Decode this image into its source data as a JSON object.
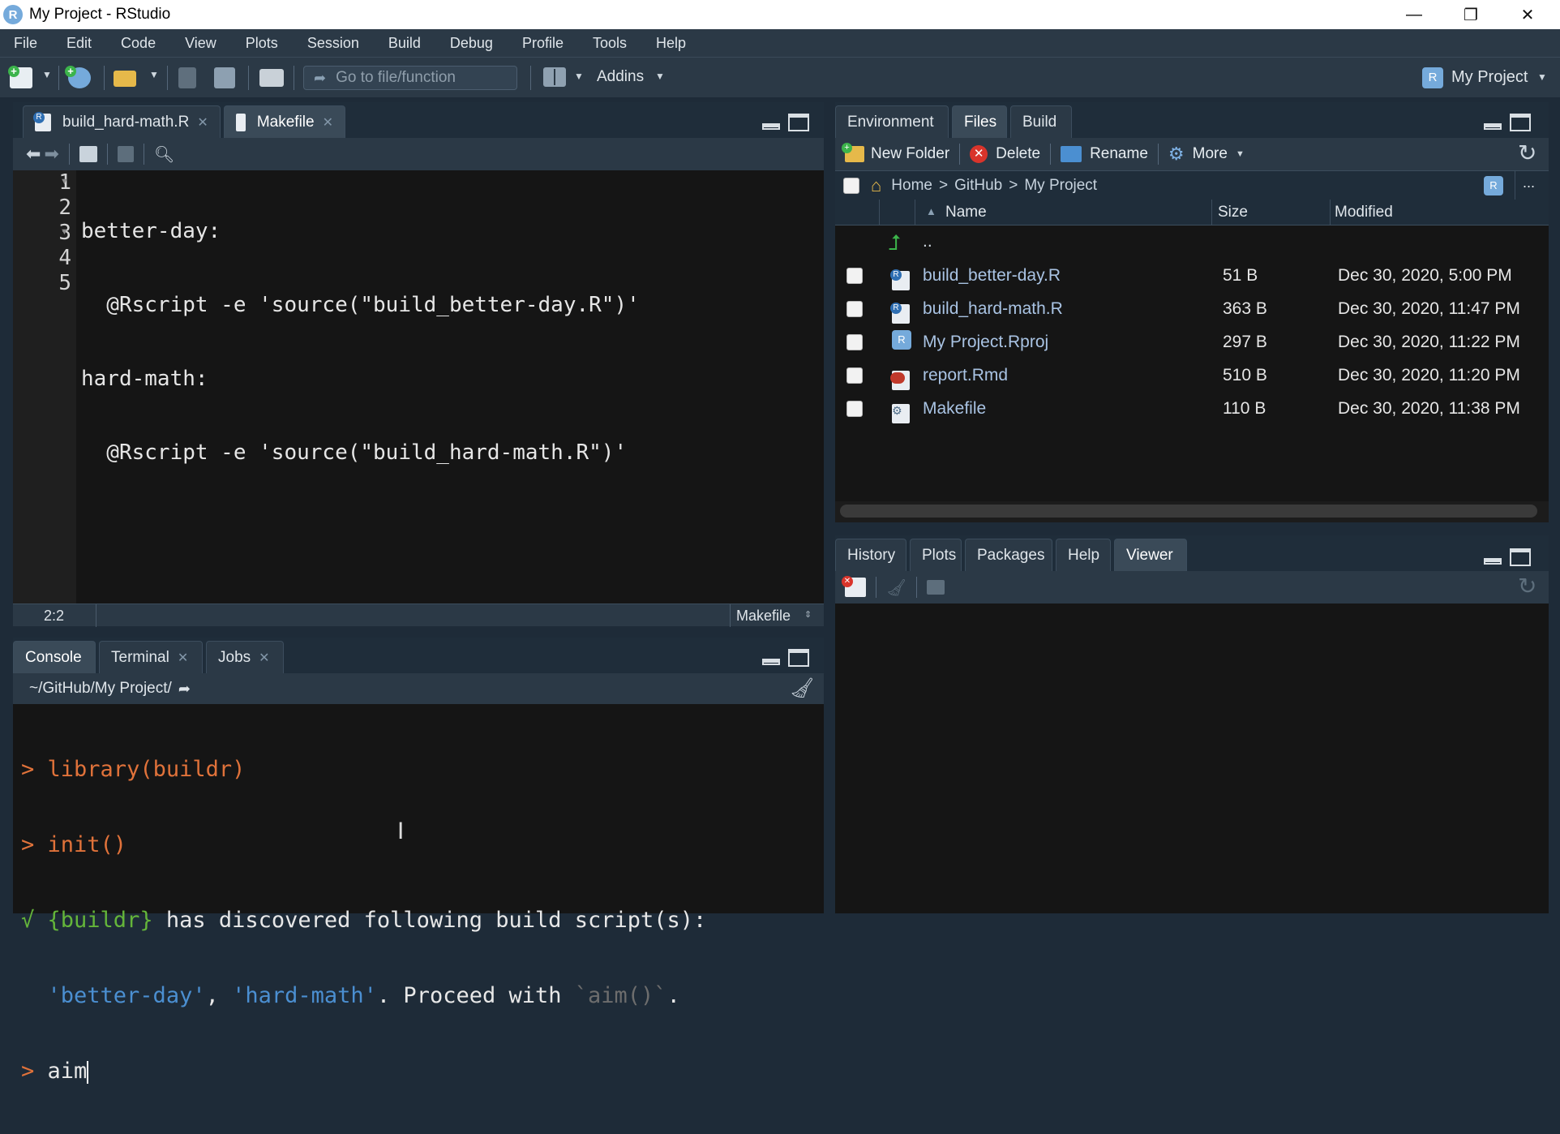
{
  "window": {
    "title": "My Project - RStudio",
    "minimize": "—",
    "restore": "❐",
    "close": "✕"
  },
  "menubar": [
    "File",
    "Edit",
    "Code",
    "View",
    "Plots",
    "Session",
    "Build",
    "Debug",
    "Profile",
    "Tools",
    "Help"
  ],
  "toolbar": {
    "goto_placeholder": "Go to file/function",
    "addins_label": "Addins",
    "project_label": "My Project"
  },
  "editor": {
    "tabs": [
      {
        "label": "build_hard-math.R"
      },
      {
        "label": "Makefile"
      }
    ],
    "line_numbers": [
      "1",
      "2",
      "3",
      "4",
      "5"
    ],
    "lines": [
      "better-day:",
      "  @Rscript -e 'source(\"build_better-day.R\")'",
      "hard-math:",
      "  @Rscript -e 'source(\"build_hard-math.R\")'",
      ""
    ],
    "cursor_pos": "2:2",
    "file_type": "Makefile"
  },
  "console": {
    "tabs": [
      {
        "label": "Console"
      },
      {
        "label": "Terminal"
      },
      {
        "label": "Jobs"
      }
    ],
    "path": "~/GitHub/My Project/",
    "prompt": ">",
    "check": "√",
    "cmd1": "library(buildr)",
    "cmd2": "init()",
    "msg_pkg": "{buildr}",
    "msg_text": " has discovered following build script(s):",
    "msg_s1": "'better-day'",
    "msg_comma": ", ",
    "msg_s2": "'hard-math'",
    "msg_proceed": ". Proceed with ",
    "msg_aim": "`aim()`",
    "msg_end": ".",
    "cmd3": "aim"
  },
  "files_pane": {
    "tabs": [
      {
        "label": "Environment"
      },
      {
        "label": "Files"
      },
      {
        "label": "Build"
      }
    ],
    "actions": {
      "new_folder": "New Folder",
      "delete": "Delete",
      "rename": "Rename",
      "more": "More"
    },
    "breadcrumb": {
      "home": "Home",
      "sep": ">",
      "github": "GitHub",
      "project": "My Project"
    },
    "columns": {
      "name": "Name",
      "size": "Size",
      "modified": "Modified"
    },
    "parent_dir": "..",
    "files": [
      {
        "name": "build_better-day.R",
        "size": "51 B",
        "modified": "Dec 30, 2020, 5:00 PM"
      },
      {
        "name": "build_hard-math.R",
        "size": "363 B",
        "modified": "Dec 30, 2020, 11:47 PM"
      },
      {
        "name": "My Project.Rproj",
        "size": "297 B",
        "modified": "Dec 30, 2020, 11:22 PM"
      },
      {
        "name": "report.Rmd",
        "size": "510 B",
        "modified": "Dec 30, 2020, 11:20 PM"
      },
      {
        "name": "Makefile",
        "size": "110 B",
        "modified": "Dec 30, 2020, 11:38 PM"
      }
    ]
  },
  "viewer_pane": {
    "tabs": [
      {
        "label": "History"
      },
      {
        "label": "Plots"
      },
      {
        "label": "Packages"
      },
      {
        "label": "Help"
      },
      {
        "label": "Viewer"
      }
    ]
  },
  "colors": {
    "accent": "#75aadb",
    "background": "#1e2b38",
    "prompt": "#e0723a",
    "success": "#64b53a",
    "string": "#4b8fd1"
  }
}
